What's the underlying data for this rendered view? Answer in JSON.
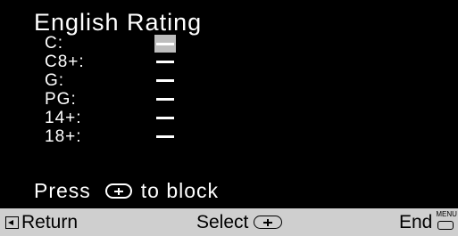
{
  "title": "English Rating",
  "rows": [
    {
      "label": "C:",
      "value": "—",
      "selected": true
    },
    {
      "label": "C8+:",
      "value": "—",
      "selected": false
    },
    {
      "label": "G:",
      "value": "—",
      "selected": false
    },
    {
      "label": "PG:",
      "value": "—",
      "selected": false
    },
    {
      "label": "14+:",
      "value": "—",
      "selected": false
    },
    {
      "label": "18+:",
      "value": "—",
      "selected": false
    }
  ],
  "hint": {
    "before": "Press",
    "icon": "joystick-button-icon",
    "after": "to block"
  },
  "footer": {
    "return_label": "Return",
    "return_icon": "return-arrow-icon",
    "select_label": "Select",
    "select_icon": "joystick-button-icon",
    "end_label": "End",
    "end_icon": "menu-button-icon",
    "menu_text": "MENU"
  }
}
